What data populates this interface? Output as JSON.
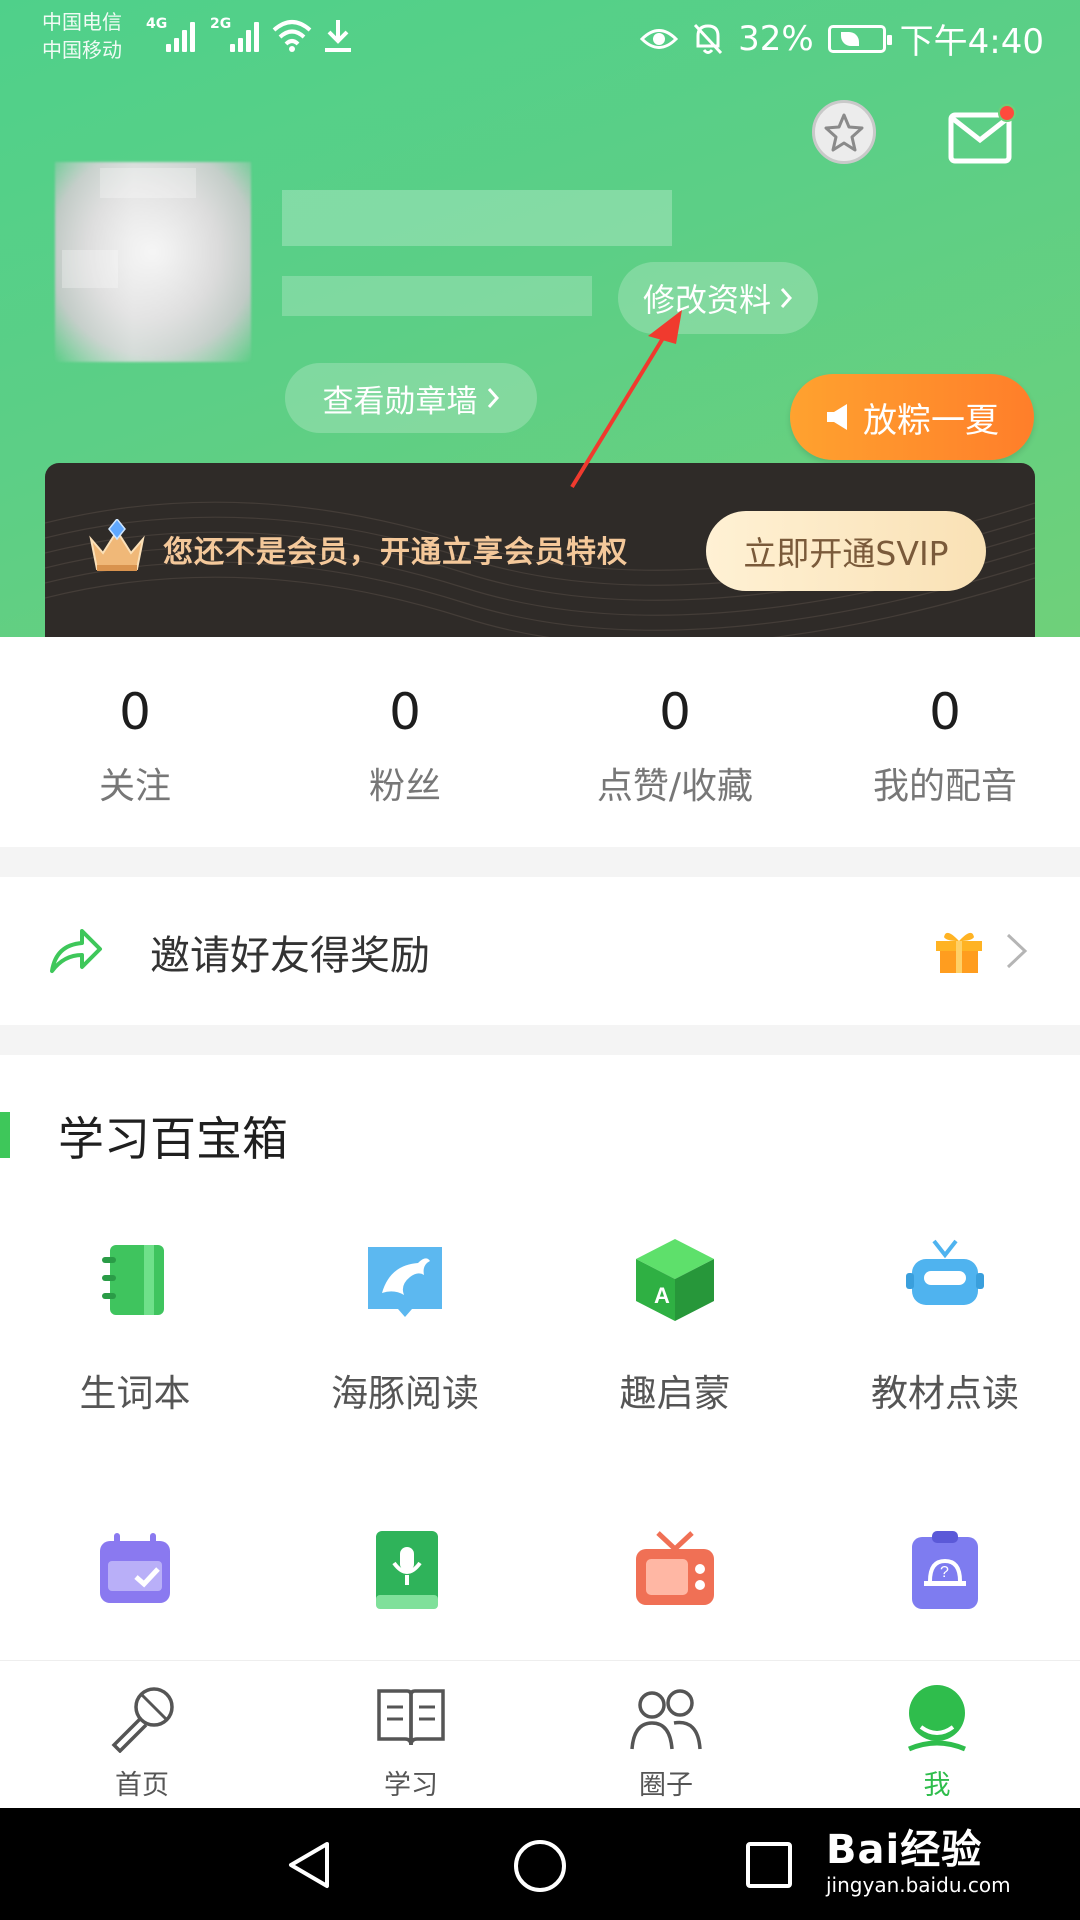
{
  "status_bar": {
    "carrier1": "中国电信",
    "carrier2": "中国移动",
    "net1": "4G",
    "net2": "2G",
    "battery": "32%",
    "time": "下午4:40"
  },
  "profile": {
    "edit_label": "修改资料",
    "badge_wall_label": "查看勋章墙",
    "promo_label": "放粽一夏"
  },
  "vip": {
    "message": "您还不是会员，开通立享会员特权",
    "button": "立即开通SVIP"
  },
  "stats": [
    {
      "value": "0",
      "label": "关注"
    },
    {
      "value": "0",
      "label": "粉丝"
    },
    {
      "value": "0",
      "label": "点赞/收藏"
    },
    {
      "value": "0",
      "label": "我的配音"
    }
  ],
  "invite": {
    "label": "邀请好友得奖励"
  },
  "toolbox": {
    "title": "学习百宝箱",
    "items": [
      {
        "label": "生词本",
        "icon": "notebook-icon"
      },
      {
        "label": "海豚阅读",
        "icon": "dolphin-book-icon"
      },
      {
        "label": "趣启蒙",
        "icon": "letter-cube-icon"
      },
      {
        "label": "教材点读",
        "icon": "robot-icon"
      },
      {
        "label": "",
        "icon": "calendar-check-icon"
      },
      {
        "label": "",
        "icon": "mic-book-icon"
      },
      {
        "label": "",
        "icon": "tv-icon"
      },
      {
        "label": "",
        "icon": "question-clipboard-icon"
      }
    ]
  },
  "tabs": [
    {
      "label": "首页",
      "icon": "microphone-icon"
    },
    {
      "label": "学习",
      "icon": "open-book-icon"
    },
    {
      "label": "圈子",
      "icon": "people-icon"
    },
    {
      "label": "我",
      "icon": "profile-icon",
      "active": true
    }
  ],
  "watermark": {
    "brand": "Bai经验",
    "url": "jingyan.baidu.com"
  },
  "colors": {
    "header_green": "#5ccf86",
    "accent_green": "#2fbd4c",
    "promo_orange": "#ff8a2c",
    "vip_dark": "#2f2b28",
    "vip_gold": "#f4c89a"
  }
}
